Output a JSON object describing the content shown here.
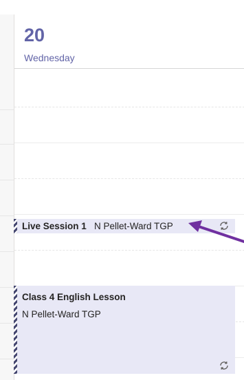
{
  "day": {
    "number": "20",
    "name": "Wednesday"
  },
  "events": [
    {
      "title": "Live Session 1",
      "organizer": "N Pellet-Ward TGP",
      "recurring": true
    },
    {
      "title": "Class 4 English Lesson",
      "organizer": "N Pellet-Ward TGP",
      "recurring": true
    }
  ],
  "icons": {
    "recurring": "recurring-icon",
    "annotation": "arrow-annotation-icon"
  },
  "colors": {
    "accent": "#6264a7",
    "event_background": "#e8e8f6",
    "event_stripe": "#44466f",
    "annotation_arrow": "#7030a0"
  }
}
